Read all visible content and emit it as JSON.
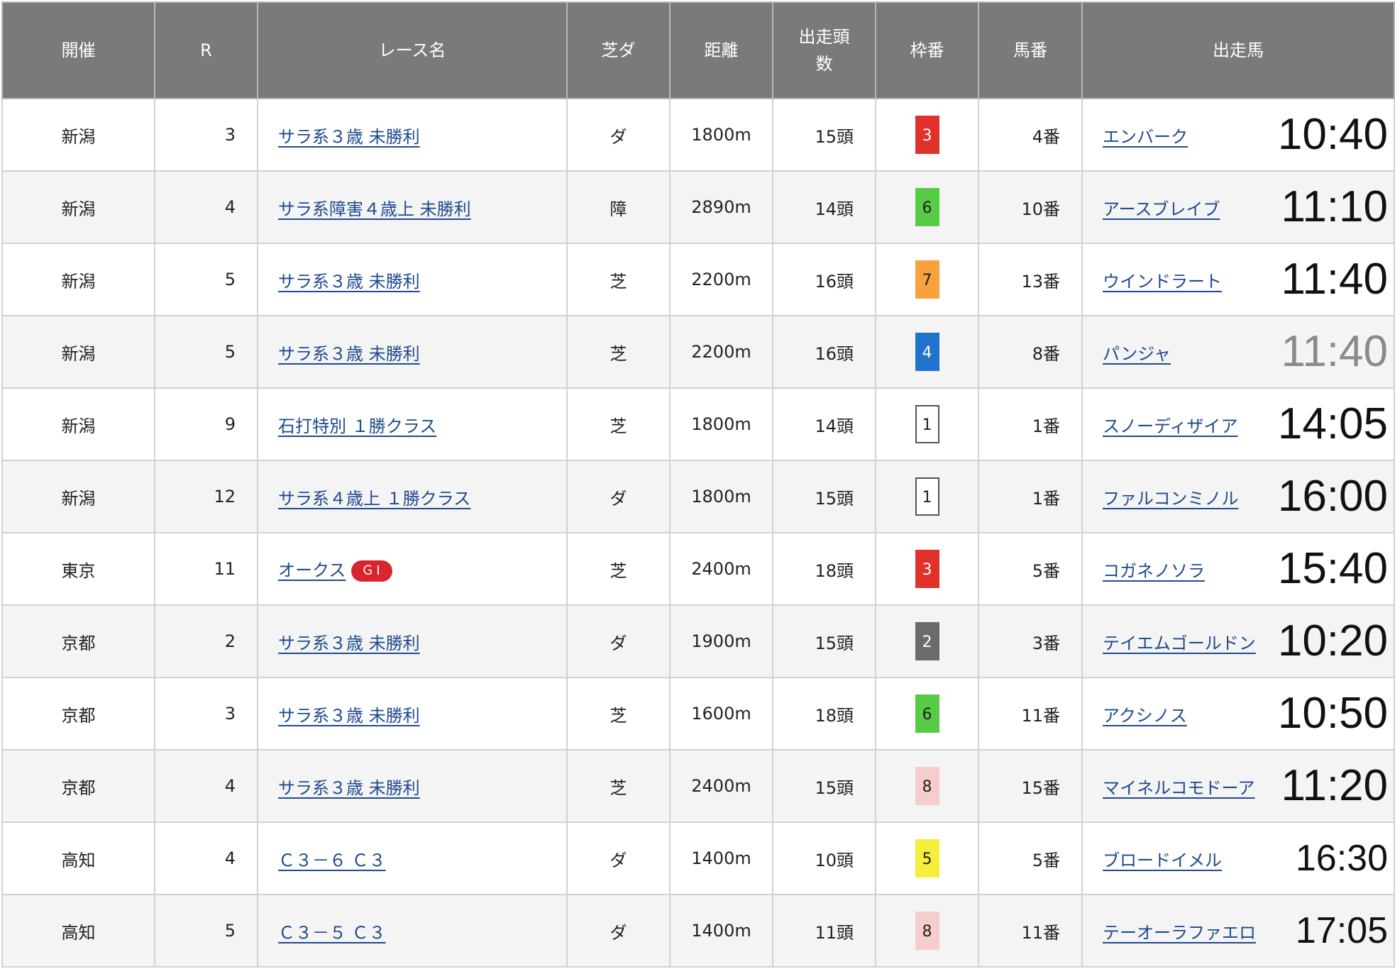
{
  "header": {
    "venue": "開催",
    "race_no": "R",
    "race_name": "レース名",
    "surface": "芝ダ",
    "distance": "距離",
    "runners_line1": "出走頭",
    "runners_line2": "数",
    "frame": "枠番",
    "horse_no": "馬番",
    "horse": "出走馬"
  },
  "colors": {
    "header_bg": "#7a7a7a",
    "link": "#1e4a8f",
    "grade_badge": "#d9262e"
  },
  "rows": [
    {
      "venue": "新潟",
      "race_no": "3",
      "race_name": "サラ系３歳 未勝利",
      "grade": "",
      "surface": "ダ",
      "distance": "1800m",
      "runners": "15頭",
      "frame": "3",
      "frame_bg": "#e0312b",
      "frame_fg": "#ffffff",
      "frame_border": "#e0312b",
      "horse_no": "4番",
      "horse": "エンバーク",
      "time": "10:40",
      "time_color": "#111111",
      "time_size": 62
    },
    {
      "venue": "新潟",
      "race_no": "4",
      "race_name": "サラ系障害４歳上 未勝利",
      "grade": "",
      "surface": "障",
      "distance": "2890m",
      "runners": "14頭",
      "frame": "6",
      "frame_bg": "#55cc44",
      "frame_fg": "#222222",
      "frame_border": "#55cc44",
      "horse_no": "10番",
      "horse": "アースブレイブ",
      "time": "11:10",
      "time_color": "#111111",
      "time_size": 62
    },
    {
      "venue": "新潟",
      "race_no": "5",
      "race_name": "サラ系３歳 未勝利",
      "grade": "",
      "surface": "芝",
      "distance": "2200m",
      "runners": "16頭",
      "frame": "7",
      "frame_bg": "#f7a23e",
      "frame_fg": "#222222",
      "frame_border": "#f7a23e",
      "horse_no": "13番",
      "horse": "ウインドラート",
      "time": "11:40",
      "time_color": "#111111",
      "time_size": 62
    },
    {
      "venue": "新潟",
      "race_no": "5",
      "race_name": "サラ系３歳 未勝利",
      "grade": "",
      "surface": "芝",
      "distance": "2200m",
      "runners": "16頭",
      "frame": "4",
      "frame_bg": "#1f73cc",
      "frame_fg": "#ffffff",
      "frame_border": "#1f73cc",
      "horse_no": "8番",
      "horse": "パンジャ",
      "time": "11:40",
      "time_color": "#8a8a8a",
      "time_size": 62
    },
    {
      "venue": "新潟",
      "race_no": "9",
      "race_name": "石打特別 １勝クラス",
      "grade": "",
      "surface": "芝",
      "distance": "1800m",
      "runners": "14頭",
      "frame": "1",
      "frame_bg": "#ffffff",
      "frame_fg": "#222222",
      "frame_border": "#555555",
      "horse_no": "1番",
      "horse": "スノーディザイア",
      "time": "14:05",
      "time_color": "#111111",
      "time_size": 62
    },
    {
      "venue": "新潟",
      "race_no": "12",
      "race_name": "サラ系４歳上 １勝クラス",
      "grade": "",
      "surface": "ダ",
      "distance": "1800m",
      "runners": "15頭",
      "frame": "1",
      "frame_bg": "#ffffff",
      "frame_fg": "#222222",
      "frame_border": "#555555",
      "horse_no": "1番",
      "horse": "ファルコンミノル",
      "time": "16:00",
      "time_color": "#111111",
      "time_size": 62
    },
    {
      "venue": "東京",
      "race_no": "11",
      "race_name": "オークス",
      "grade": "ＧⅠ",
      "surface": "芝",
      "distance": "2400m",
      "runners": "18頭",
      "frame": "3",
      "frame_bg": "#e0312b",
      "frame_fg": "#ffffff",
      "frame_border": "#e0312b",
      "horse_no": "5番",
      "horse": "コガネノソラ",
      "time": "15:40",
      "time_color": "#111111",
      "time_size": 62
    },
    {
      "venue": "京都",
      "race_no": "2",
      "race_name": "サラ系３歳 未勝利",
      "grade": "",
      "surface": "ダ",
      "distance": "1900m",
      "runners": "15頭",
      "frame": "2",
      "frame_bg": "#6b6b6b",
      "frame_fg": "#ffffff",
      "frame_border": "#6b6b6b",
      "horse_no": "3番",
      "horse": "テイエムゴールドン",
      "time": "10:20",
      "time_color": "#111111",
      "time_size": 62
    },
    {
      "venue": "京都",
      "race_no": "3",
      "race_name": "サラ系３歳 未勝利",
      "grade": "",
      "surface": "芝",
      "distance": "1600m",
      "runners": "18頭",
      "frame": "6",
      "frame_bg": "#55cc44",
      "frame_fg": "#222222",
      "frame_border": "#55cc44",
      "horse_no": "11番",
      "horse": "アクシノス",
      "time": "10:50",
      "time_color": "#111111",
      "time_size": 62
    },
    {
      "venue": "京都",
      "race_no": "4",
      "race_name": "サラ系３歳 未勝利",
      "grade": "",
      "surface": "芝",
      "distance": "2400m",
      "runners": "15頭",
      "frame": "8",
      "frame_bg": "#f6cccc",
      "frame_fg": "#222222",
      "frame_border": "#f6cccc",
      "horse_no": "15番",
      "horse": "マイネルコモドーア",
      "time": "11:20",
      "time_color": "#111111",
      "time_size": 62
    },
    {
      "venue": "高知",
      "race_no": "4",
      "race_name": "Ｃ３－６ Ｃ３",
      "grade": "",
      "surface": "ダ",
      "distance": "1400m",
      "runners": "10頭",
      "frame": "5",
      "frame_bg": "#f5ee3a",
      "frame_fg": "#222222",
      "frame_border": "#f5ee3a",
      "horse_no": "5番",
      "horse": "ブロードイメル",
      "time": "16:30",
      "time_color": "#111111",
      "time_size": 52
    },
    {
      "venue": "高知",
      "race_no": "5",
      "race_name": "Ｃ３－５ Ｃ３",
      "grade": "",
      "surface": "ダ",
      "distance": "1400m",
      "runners": "11頭",
      "frame": "8",
      "frame_bg": "#f6cccc",
      "frame_fg": "#222222",
      "frame_border": "#f6cccc",
      "horse_no": "11番",
      "horse": "テーオーラファエロ",
      "time": "17:05",
      "time_color": "#111111",
      "time_size": 52
    }
  ]
}
